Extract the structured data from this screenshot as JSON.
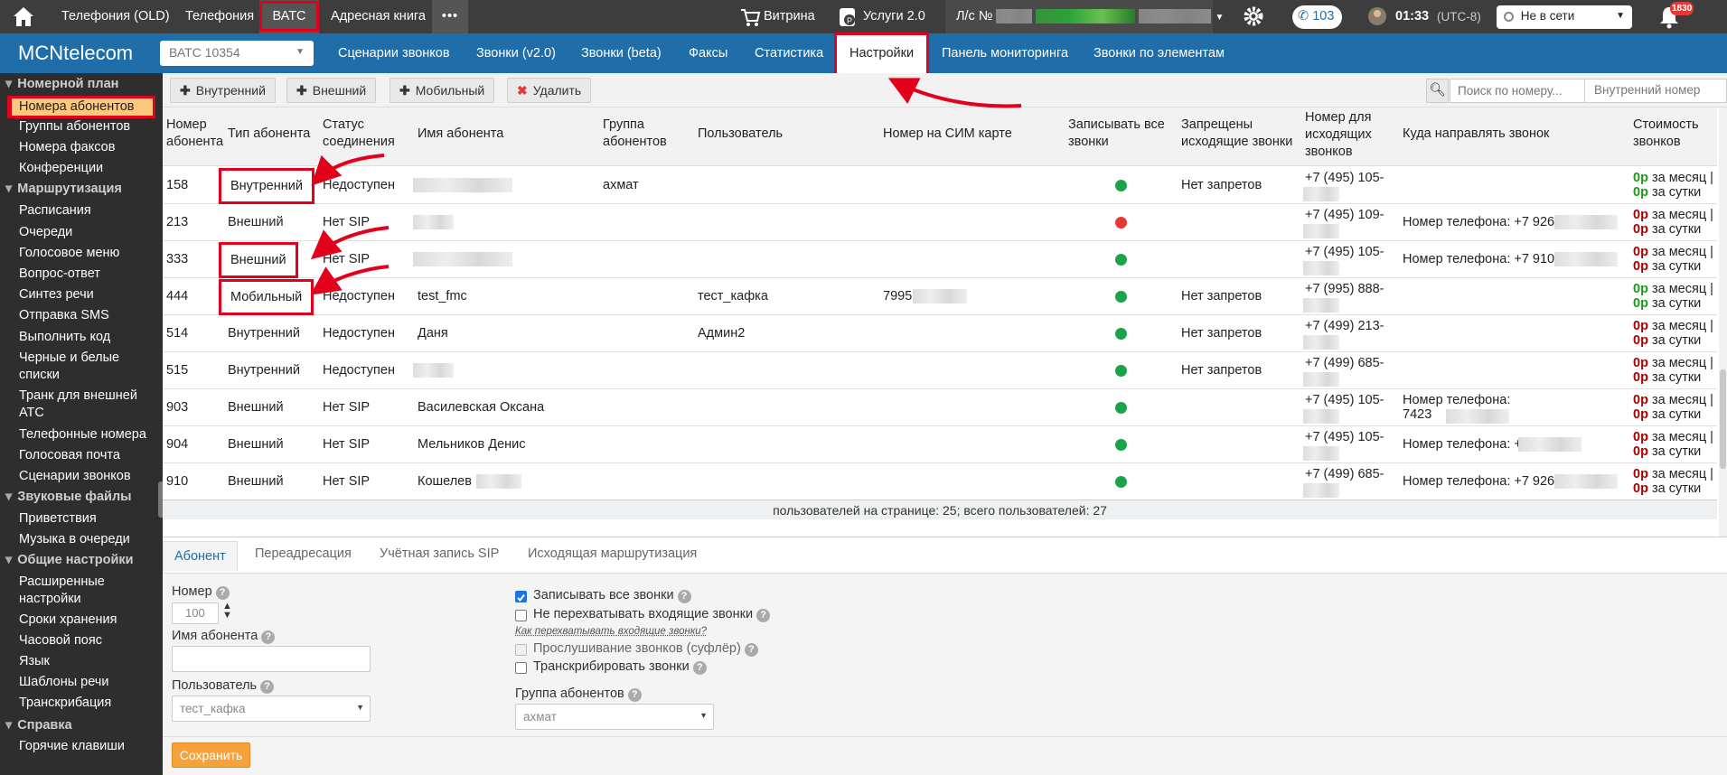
{
  "topbar": {
    "items": [
      "Телефония (OLD)",
      "Телефония",
      "ВАТС",
      "Адресная книга"
    ],
    "more": "•••",
    "vitrina": "Витрина",
    "services": "Услуги 2.0",
    "account_label": "Л/с №",
    "phone_badge": "103",
    "time": "01:33",
    "timezone": "(UTC-8)",
    "status": "Не в сети",
    "notif_count": "1830"
  },
  "nav": {
    "logo": "MCNtelecom",
    "vats_select": "ВАТС 10354",
    "tabs": [
      "Сценарии звонков",
      "Звонки (v2.0)",
      "Звонки (beta)",
      "Факсы",
      "Статистика",
      "Настройки",
      "Панель мониторинга",
      "Звонки по элементам"
    ]
  },
  "sidebar": {
    "sections": [
      {
        "title": "Номерной план",
        "items": [
          "Номера абонентов",
          "Группы абонентов",
          "Номера факсов",
          "Конференции"
        ]
      },
      {
        "title": "Маршрутизация",
        "items": [
          "Расписания",
          "Очереди",
          "Голосовое меню",
          "Вопрос-ответ",
          "Синтез речи",
          "Отправка SMS",
          "Выполнить код",
          "Черные и белые списки",
          "Транк для внешней АТС",
          "Телефонные номера",
          "Голосовая почта",
          "Сценарии звонков"
        ]
      },
      {
        "title": "Звуковые файлы",
        "items": [
          "Приветствия",
          "Музыка в очереди"
        ]
      },
      {
        "title": "Общие настройки",
        "items": [
          "Расширенные настройки",
          "Сроки хранения",
          "Часовой пояс",
          "Язык",
          "Шаблоны речи",
          "Транскрибация"
        ]
      },
      {
        "title": "Справка",
        "items": [
          "Горячие клавиши"
        ]
      }
    ]
  },
  "toolbar": {
    "add_internal": "Внутренний",
    "add_external": "Внешний",
    "add_mobile": "Мобильный",
    "delete": "Удалить",
    "search_placeholder": "Поиск по номеру...",
    "filter": "Внутренний номер"
  },
  "table": {
    "columns": [
      "Номер абонента",
      "Тип абонента",
      "Статус соединения",
      "Имя абонента",
      "Группа абонентов",
      "Пользователь",
      "Номер на СИМ карте",
      "Записывать все звонки",
      "Запрещены исходящие звонки",
      "Номер для исходящих звонков",
      "Куда направлять звонок",
      "Стоимость звонков"
    ],
    "rows": [
      {
        "num": "158",
        "type": "Внутренний",
        "status": "Недоступен",
        "name": "",
        "group": "ахмат",
        "user": "",
        "sim": "",
        "rec": "green",
        "ban": "Нет запретов",
        "out": "+7 (495) 105-",
        "fwd": ""
      },
      {
        "num": "213",
        "type": "Внешний",
        "status": "Нет SIP",
        "name": "",
        "group": "",
        "user": "",
        "sim": "",
        "rec": "red",
        "ban": "",
        "out": "+7 (495) 109-",
        "fwd": "Номер телефона: +7 926"
      },
      {
        "num": "333",
        "type": "Внешний",
        "status": "Нет SIP",
        "name": "",
        "group": "",
        "user": "",
        "sim": "",
        "rec": "green",
        "ban": "",
        "out": "+7 (495) 105-",
        "fwd": "Номер телефона: +7 910"
      },
      {
        "num": "444",
        "type": "Мобильный",
        "status": "Недоступен",
        "name": "test_fmc",
        "group": "",
        "user": "тест_кафка",
        "sim": "7995",
        "rec": "green",
        "ban": "Нет запретов",
        "out": "+7 (995) 888-",
        "fwd": ""
      },
      {
        "num": "514",
        "type": "Внутренний",
        "status": "Недоступен",
        "name": "Даня",
        "group": "",
        "user": "Админ2",
        "sim": "",
        "rec": "green",
        "ban": "Нет запретов",
        "out": "+7 (499) 213-",
        "fwd": ""
      },
      {
        "num": "515",
        "type": "Внутренний",
        "status": "Недоступен",
        "name": "",
        "group": "",
        "user": "",
        "sim": "",
        "rec": "green",
        "ban": "Нет запретов",
        "out": "+7 (499) 685-",
        "fwd": ""
      },
      {
        "num": "903",
        "type": "Внешний",
        "status": "Нет SIP",
        "name": "Василевская Оксана",
        "group": "",
        "user": "",
        "sim": "",
        "rec": "green",
        "ban": "",
        "out": "+7 (495) 105-",
        "fwd": "Номер телефона: 7423"
      },
      {
        "num": "904",
        "type": "Внешний",
        "status": "Нет SIP",
        "name": "Мельников Денис",
        "group": "",
        "user": "",
        "sim": "",
        "rec": "green",
        "ban": "",
        "out": "+7 (495) 105-",
        "fwd": "Номер телефона: +1"
      },
      {
        "num": "910",
        "type": "Внешний",
        "status": "Нет SIP",
        "name": "Кошелев",
        "group": "",
        "user": "",
        "sim": "",
        "rec": "green",
        "ban": "",
        "out": "+7 (499) 685-",
        "fwd": "Номер телефона: +7 926"
      }
    ],
    "cost_zero": "0р",
    "cost_month": "за месяц |",
    "cost_day": "за сутки",
    "pager": "пользователей на странице: 25; всего пользователей: 27",
    "dot_colors": {
      "green": "#1aa34a",
      "red": "#e53935"
    }
  },
  "form": {
    "tabs": [
      "Абонент",
      "Переадресация",
      "Учётная запись SIP",
      "Исходящая маршрутизация"
    ],
    "number_label": "Номер",
    "number_value": "100",
    "name_label": "Имя абонента",
    "user_label": "Пользователь",
    "user_value": "тест_кафка",
    "rec_all": "Записывать все звонки",
    "no_intercept": "Не перехватывать входящие звонки",
    "how_intercept": "Как перехватывать входящие звонки?",
    "whisper": "Прослушивание звонков (суфлёр)",
    "transcribe": "Транскрибировать звонки",
    "group_label": "Группа абонентов",
    "group_value": "ахмат",
    "save": "Сохранить"
  }
}
